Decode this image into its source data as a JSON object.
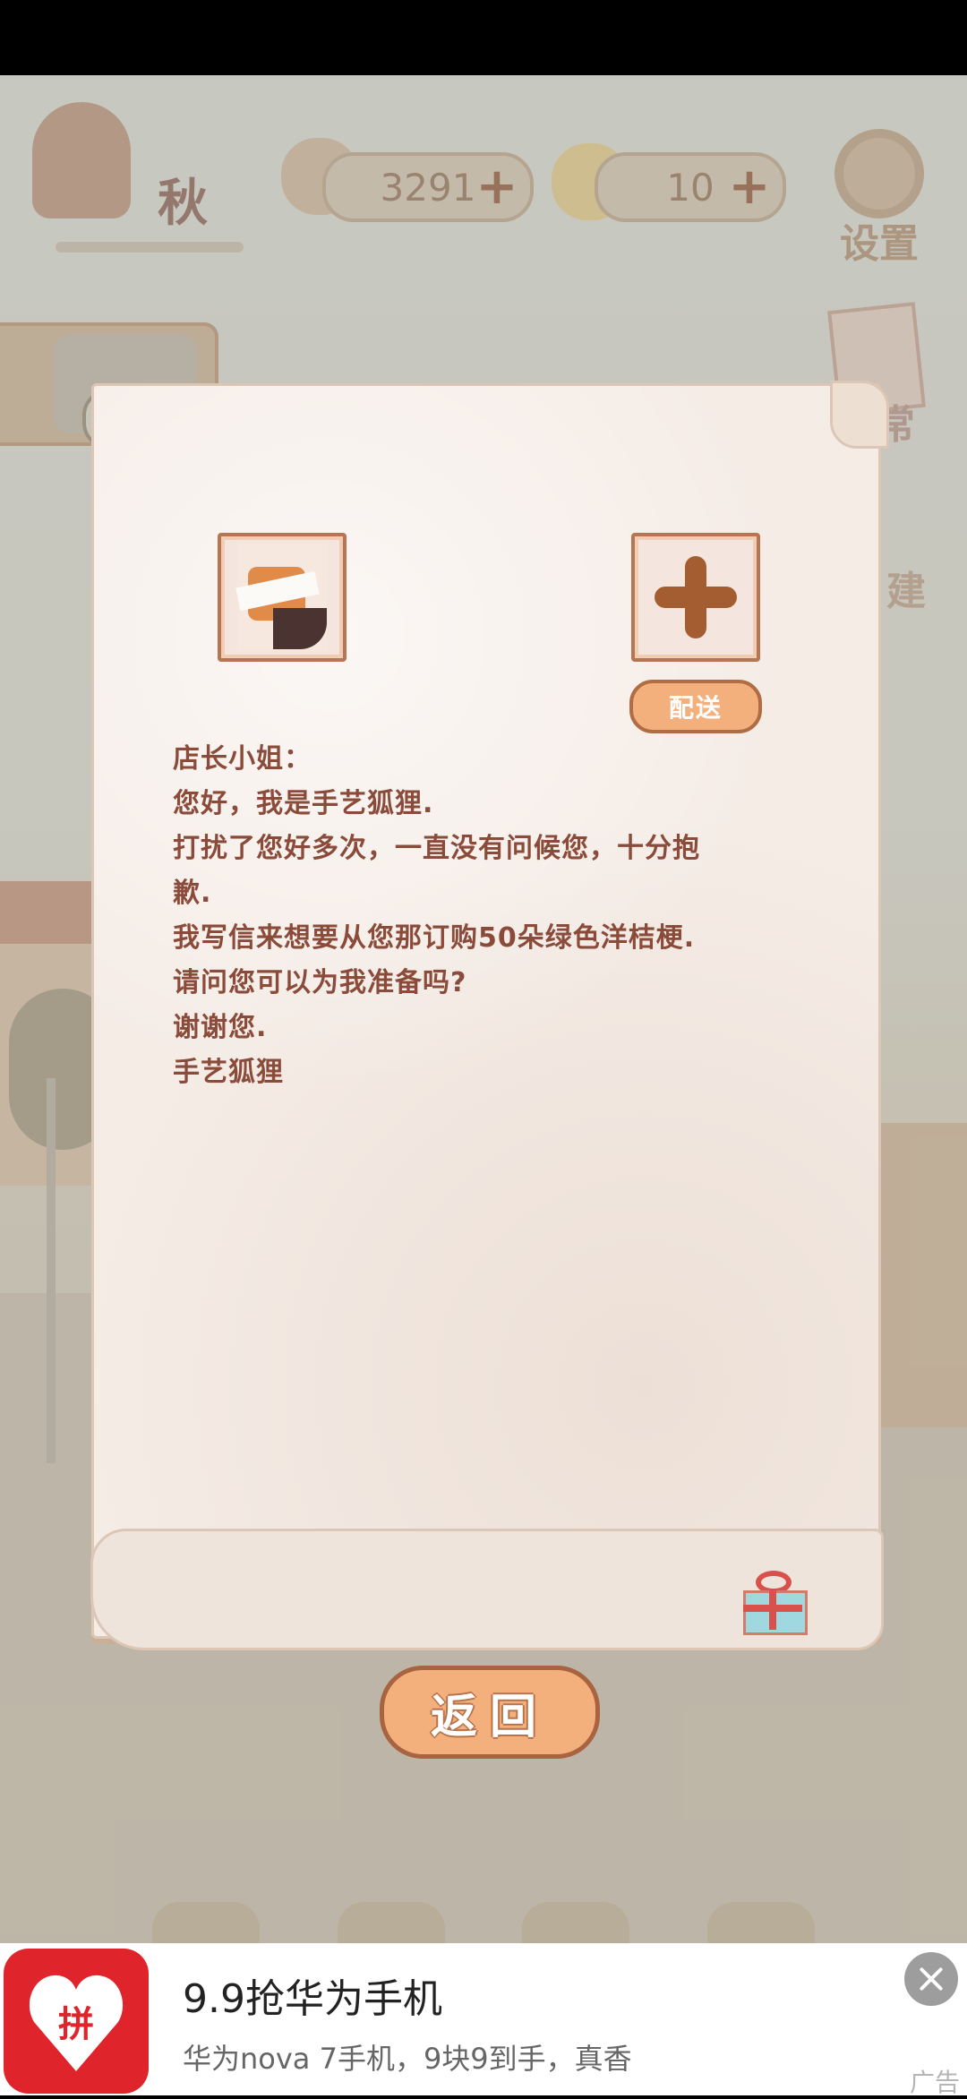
{
  "hud": {
    "season": "秋",
    "fish_count": "3291",
    "cheese_count": "10",
    "settings_label": "设置",
    "daily_label": "日常",
    "build_label": "建"
  },
  "letter": {
    "deliver_label": "配送",
    "lines": [
      "店长小姐：",
      "您好，我是手艺狐狸.",
      "打扰了您好多次，一直没有问候您，十分抱",
      "歉.",
      "我写信来想要从您那订购50朵绿色洋桔梗.",
      "请问您可以为我准备吗?",
      "谢谢您.",
      "手艺狐狸"
    ]
  },
  "return_label": "返回",
  "ad": {
    "logo_text": "拼",
    "title": "9.9抢华为手机",
    "subtitle": "华为nova 7手机，9块9到手，真香",
    "tag": "广告"
  },
  "colors": {
    "letter_text": "#8a4b3a",
    "button_fill": "#f3b07c",
    "button_border": "#a86440",
    "ad_brand": "#e0242b"
  }
}
